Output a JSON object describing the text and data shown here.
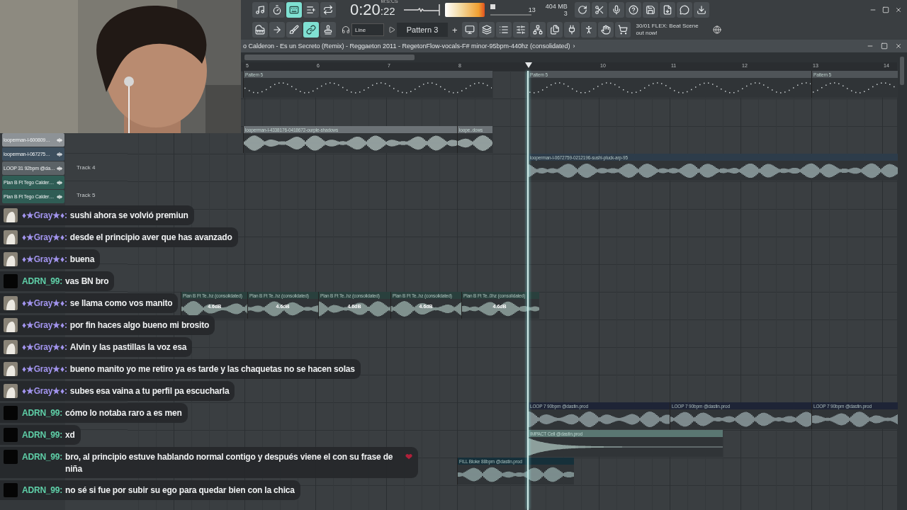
{
  "toolbar": {
    "mode_buttons": [
      {
        "selected": false
      },
      {
        "selected": false
      },
      {
        "selected": true
      },
      {
        "selected": false
      },
      {
        "selected": false
      }
    ],
    "time_unit": "M:S:CS",
    "time_main": "0:20",
    "time_small": ":22",
    "cpu": "13",
    "memory": "404 MB",
    "polyphony": "3",
    "tools": [
      {
        "selected": false
      },
      {
        "selected": false
      },
      {
        "selected": false
      },
      {
        "selected": true
      },
      {
        "selected": false
      }
    ],
    "snap": "Line",
    "pattern": "Pattern 3",
    "add_pattern": "+",
    "news_date": "30/01",
    "news": "FLEX: Beat Scene out now!"
  },
  "playlist": {
    "title": "o Calderon - Es un Secreto (Remix) - Reggaeton 2011 - RegetonFlow-vocals-F# minor-95bpm-440hz (consolidated)",
    "title_arrow": "›",
    "ruler": [
      "5",
      "6",
      "7",
      "8",
      "10",
      "11",
      "12",
      "13",
      "14"
    ],
    "picker": [
      {
        "label": "looperman-l-600809…",
        "color": "#8d9296"
      },
      {
        "label": "looperman-l-067275…",
        "color": "#3d4f5e"
      },
      {
        "label": "LOOP 31 92bpm @da…",
        "color": "#5b6266"
      },
      {
        "label": "Plan B Ft Tego Calder…",
        "color": "#2f5d55"
      },
      {
        "label": "Plan B Ft Tego Calder…",
        "color": "#2f5d55"
      }
    ],
    "tracks": [
      {
        "name": "Track 4"
      },
      {
        "name": "Track 5"
      }
    ],
    "clips": [
      {
        "kind": "pattern",
        "label": "Pattern 5",
        "color": "#4f5458"
      },
      {
        "kind": "pattern",
        "label": "Pattern 5",
        "color": "#4f5458"
      },
      {
        "kind": "pattern",
        "label": "Pattern 5",
        "color": "#4f5458"
      },
      {
        "kind": "audio",
        "label": "looperman-l-4338176-0418672-ourple-shadows",
        "color": "#6c7276"
      },
      {
        "kind": "audio",
        "label": "loope..dows",
        "color": "#6c7276"
      },
      {
        "kind": "audio",
        "label": "looperman-l-0672759-0212196-sushi-pluck-arp-95",
        "color": "#2d3c4a"
      },
      {
        "kind": "audio",
        "label": "Plan B Ft Te..hz (consolidated)",
        "color": "#29403d",
        "gain": "4.6dB"
      },
      {
        "kind": "audio",
        "label": "Plan B Ft Te..hz (consolidated)",
        "color": "#29403d",
        "gain": "4.6dB"
      },
      {
        "kind": "audio",
        "label": "Plan B Ft Te..hz (consolidated)",
        "color": "#29403d",
        "gain": "4.6dB"
      },
      {
        "kind": "audio",
        "label": "Plan B Ft Te..hz (consolidated)",
        "color": "#29403d",
        "gain": "4.6dB"
      },
      {
        "kind": "audio",
        "label": "Plan B Ft Te..0hz (consolidated)",
        "color": "#29403d",
        "gain": "4.6dB"
      },
      {
        "kind": "audio",
        "label": "LOOP 7 90bpm @dastin.prod",
        "color": "#1e2436"
      },
      {
        "kind": "audio",
        "label": "LOOP 7 90bpm @dastin.prod",
        "color": "#1e2436"
      },
      {
        "kind": "audio",
        "label": "LOOP 7 90bpm @dastin.prod",
        "color": "#1e2436"
      },
      {
        "kind": "hit",
        "label": "IMPACT Cell @dastin.prod",
        "color": "#5a7772"
      },
      {
        "kind": "audio",
        "label": "FILL Bloke 88bpm @dastin.prod",
        "color": "#16303a"
      }
    ]
  },
  "chat": [
    {
      "kind": "picture",
      "user": "♦★Gray★♦:",
      "color": "#a294ee",
      "text": "sushi ahora se volvió premiun"
    },
    {
      "kind": "picture",
      "user": "♦★Gray★♦:",
      "color": "#a294ee",
      "text": "desde el principio aver que has avanzado"
    },
    {
      "kind": "picture",
      "user": "♦★Gray★♦:",
      "color": "#a294ee",
      "text": "buena"
    },
    {
      "kind": "blank",
      "user": "ADRN_99:",
      "color": "#5fd0a8",
      "text": "vas BN bro"
    },
    {
      "kind": "picture",
      "user": "♦★Gray★♦:",
      "color": "#a294ee",
      "text": "se llama como vos manito"
    },
    {
      "kind": "picture",
      "user": "♦★Gray★♦:",
      "color": "#a294ee",
      "text": "por fin haces algo bueno mi brosito"
    },
    {
      "kind": "picture",
      "user": "♦★Gray★♦:",
      "color": "#a294ee",
      "text": "Alvin y las pastillas la voz esa"
    },
    {
      "kind": "picture",
      "user": "♦★Gray★♦:",
      "color": "#a294ee",
      "text": "bueno manito yo me retiro ya es tarde y las chaquetas no se hacen solas"
    },
    {
      "kind": "picture",
      "user": "♦★Gray★♦:",
      "color": "#a294ee",
      "text": "subes esa vaina a tu perfil pa escucharla"
    },
    {
      "kind": "blank",
      "user": "ADRN_99:",
      "color": "#5fd0a8",
      "text": "cómo lo notaba raro a es men"
    },
    {
      "kind": "blank",
      "user": "ADRN_99:",
      "color": "#5fd0a8",
      "text": "xd"
    },
    {
      "kind": "blank",
      "user": "ADRN_99:",
      "color": "#5fd0a8",
      "text": "bro, al principio estuve hablando normal contigo y después viene el con su frase de niña",
      "emoji": "❤"
    },
    {
      "kind": "blank",
      "user": "ADRN_99:",
      "color": "#5fd0a8",
      "text": "no sé si fue por subir su ego para quedar bien con la chica"
    }
  ]
}
